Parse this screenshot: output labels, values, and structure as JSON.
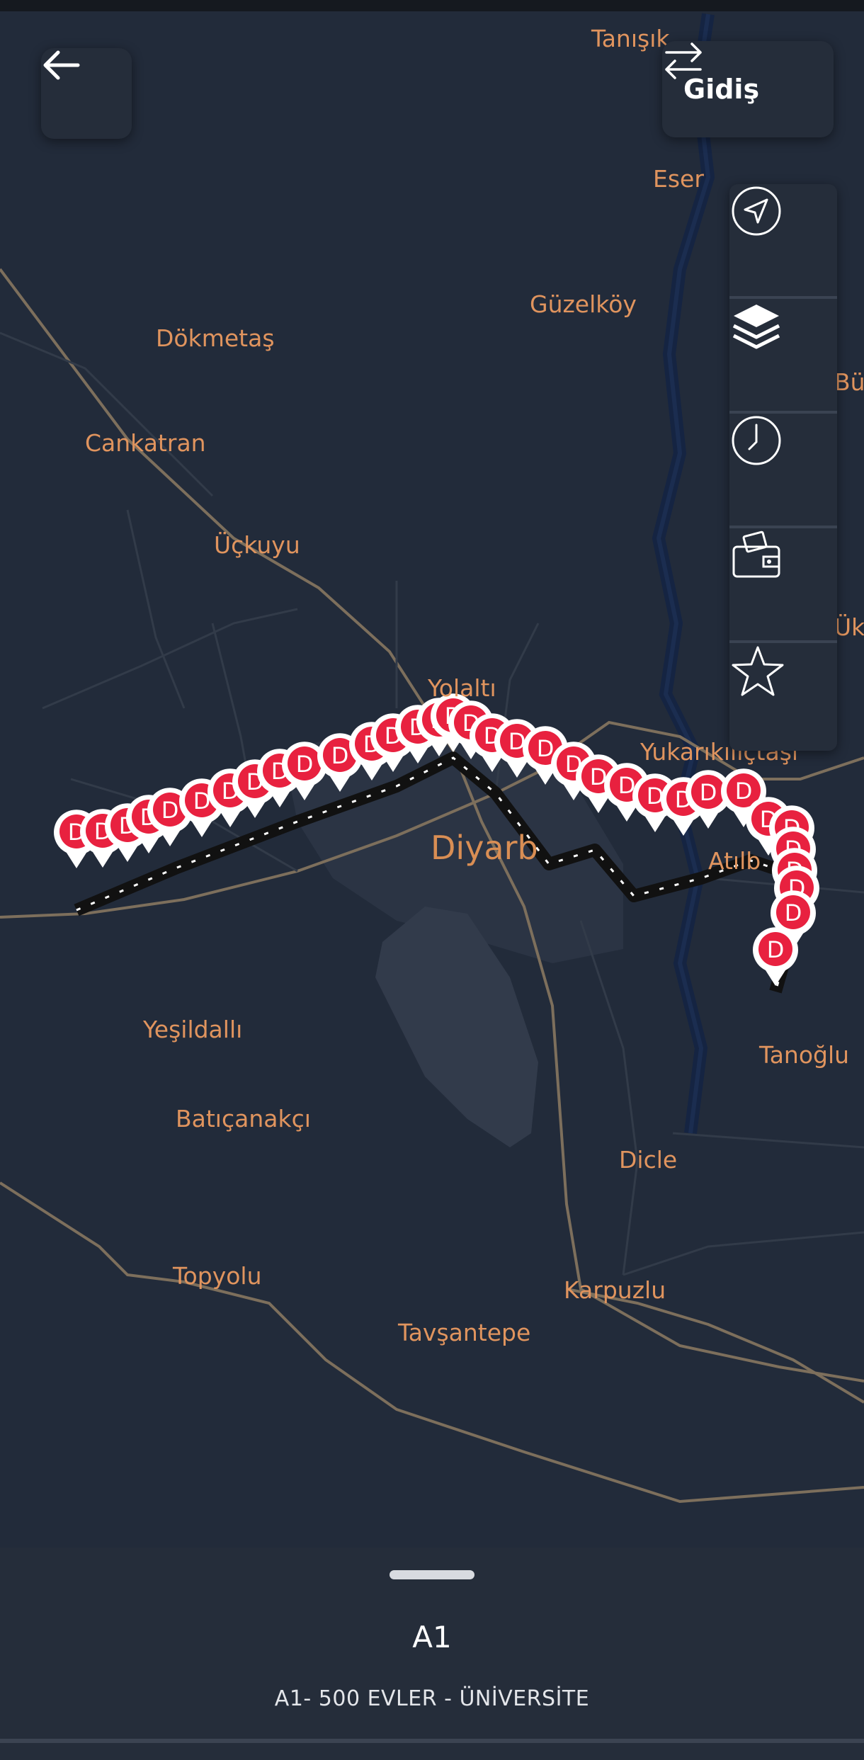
{
  "header": {
    "direction_label": "Gidiş"
  },
  "map": {
    "places": [
      {
        "name": "Tanışık"
      },
      {
        "name": "Eser"
      },
      {
        "name": "Güzelköy"
      },
      {
        "name": "Dökmetaş"
      },
      {
        "name": "Büy"
      },
      {
        "name": "Cankatran"
      },
      {
        "name": "Üçkuyu"
      },
      {
        "name": "Ük"
      },
      {
        "name": "Yolaltı"
      },
      {
        "name": "Yukarıkılıçtaşı"
      },
      {
        "name": "Diyarb"
      },
      {
        "name": "Atılb"
      },
      {
        "name": "Yeşildallı"
      },
      {
        "name": "Tanoğlu"
      },
      {
        "name": "Batıçanakçı"
      },
      {
        "name": "Dicle"
      },
      {
        "name": "Topyolu"
      },
      {
        "name": "Karpuzlu"
      },
      {
        "name": "Tavşantepe"
      }
    ],
    "stop_marker_letter": "D",
    "colors": {
      "background": "#222b3a",
      "label": "#e0945e",
      "marker": "#e8213f",
      "route": "#111111"
    }
  },
  "side_panel": {
    "buttons": [
      {
        "icon": "navigation-arrow-icon"
      },
      {
        "icon": "layers-icon"
      },
      {
        "icon": "clock-icon"
      },
      {
        "icon": "wallet-icon"
      },
      {
        "icon": "star-icon"
      }
    ]
  },
  "bottom_sheet": {
    "route_code": "A1",
    "route_name": "A1- 500 EVLER - ÜNİVERSİTE"
  }
}
